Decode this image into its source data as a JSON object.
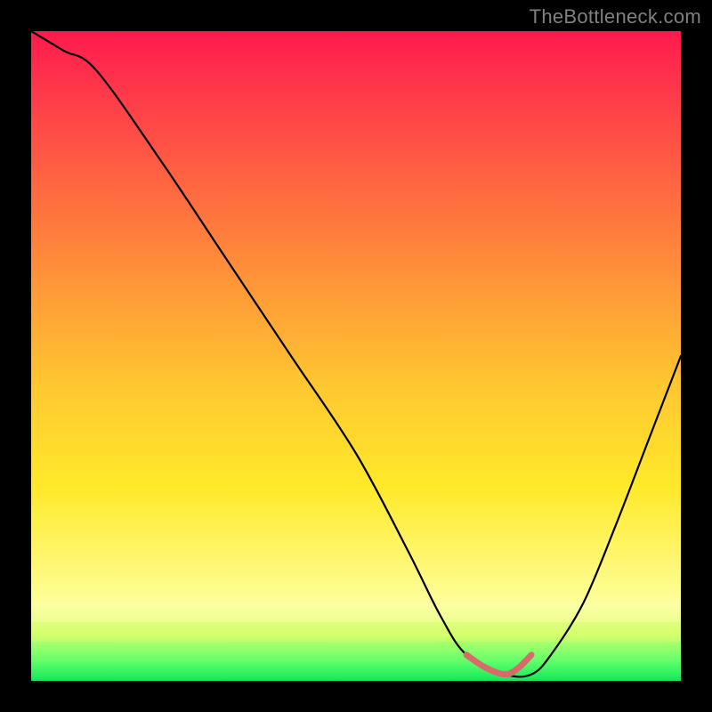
{
  "watermark": "TheBottleneck.com",
  "chart_data": {
    "type": "line",
    "title": "",
    "xlabel": "",
    "ylabel": "",
    "xlim": [
      0,
      100
    ],
    "ylim": [
      0,
      100
    ],
    "series": [
      {
        "name": "bottleneck-curve",
        "x": [
          0,
          5,
          10,
          20,
          30,
          40,
          50,
          58,
          63,
          67,
          73,
          77,
          80,
          85,
          90,
          95,
          100
        ],
        "values": [
          100,
          97,
          94,
          80,
          65,
          50,
          35,
          20,
          10,
          4,
          1,
          1,
          4,
          12,
          24,
          37,
          50
        ],
        "color": "#000000"
      },
      {
        "name": "optimal-range-marker",
        "x": [
          67,
          70,
          73,
          75,
          77
        ],
        "values": [
          4,
          2,
          1,
          2,
          4
        ],
        "color": "#d86a6a"
      }
    ],
    "gradient_stops": [
      {
        "pct": 0,
        "color": "#ff1a4d"
      },
      {
        "pct": 25,
        "color": "#ff6a40"
      },
      {
        "pct": 55,
        "color": "#ffc830"
      },
      {
        "pct": 82,
        "color": "#fff774"
      },
      {
        "pct": 97,
        "color": "#5fff6a"
      },
      {
        "pct": 100,
        "color": "#12e85a"
      }
    ]
  }
}
